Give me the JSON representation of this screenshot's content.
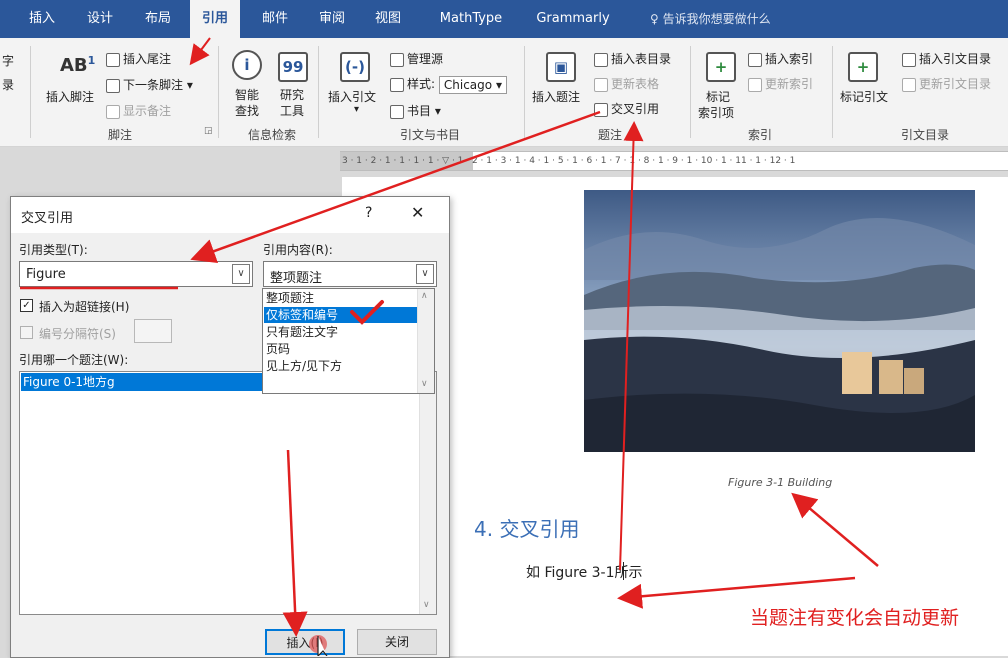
{
  "tabs": [
    "插入",
    "设计",
    "布局",
    "引用",
    "邮件",
    "审阅",
    "视图",
    "MathType",
    "Grammarly"
  ],
  "active_tab": "引用",
  "tell_me": "告诉我你想要做什么",
  "ribbon": {
    "left_partial": [
      "字",
      "录"
    ],
    "footnote_group": {
      "label": "脚注",
      "insert_footnote": "插入脚注",
      "ab_icon": "AB",
      "superscript": "1",
      "insert_endnote": "插入尾注",
      "next_footnote": "下一条脚注",
      "show_notes": "显示备注"
    },
    "research_group": {
      "label": "信息检索",
      "smart_lookup_1": "智能",
      "smart_lookup_2": "查找",
      "researcher_1": "研究",
      "researcher_2": "工具"
    },
    "citations_group": {
      "label": "引文与书目",
      "insert_citation": "插入引文",
      "manage_sources": "管理源",
      "style_label": "样式:",
      "style_value": "Chicago",
      "bibliography": "书目"
    },
    "captions_group": {
      "label": "题注",
      "insert_caption": "插入题注",
      "insert_table_of_figures": "插入表目录",
      "update_table": "更新表格",
      "cross_reference": "交叉引用"
    },
    "index_group": {
      "label": "索引",
      "mark_entry_1": "标记",
      "mark_entry_2": "索引项",
      "insert_index": "插入索引",
      "update_index": "更新索引"
    },
    "toa_group": {
      "label": "引文目录",
      "mark_citation": "标记引文",
      "insert_toa": "插入引文目录",
      "update_toa": "更新引文目录"
    }
  },
  "ruler_text": "3 · 1 · 2 · 1 · 1 · 1 · 1 · ▽ · 1 · 2 · 1 · 3 · 1 · 4 · 1 · 5 · 1 · 6 · 1 · 7 · 1 · 8 · 1 · 9 · 1 · 10 · 1 · 11 · 1 · 12 · 1",
  "document": {
    "caption": "Figure 3-1 Building",
    "heading": "4. 交叉引用",
    "body_before": "如 Figure 3-1",
    "body_after": "所示",
    "annotation": "当题注有变化会自动更新"
  },
  "dialog": {
    "title": "交叉引用",
    "help": "?",
    "close": "✕",
    "ref_type_label": "引用类型(T):",
    "ref_type_value": "Figure",
    "ref_content_label": "引用内容(R):",
    "ref_content_value": "整项题注",
    "insert_hyperlink_label": "插入为超链接(H)",
    "insert_hyperlink_checked": true,
    "separate_numbers_label": "编号分隔符(S)",
    "which_caption_label": "引用哪一个题注(W):",
    "captions_list": [
      "Figure 0-1地方g"
    ],
    "insert_button": "插入(I)",
    "close_button": "关闭"
  },
  "dropdown_options": [
    "整项题注",
    "仅标签和编号",
    "只有题注文字",
    "页码",
    "见上方/见下方"
  ],
  "dropdown_selected_index": 1,
  "colors": {
    "ribbon_blue": "#2b579a",
    "selection_blue": "#0078d7",
    "annotation_red": "#e02020",
    "heading_blue": "#3b6fb6"
  }
}
